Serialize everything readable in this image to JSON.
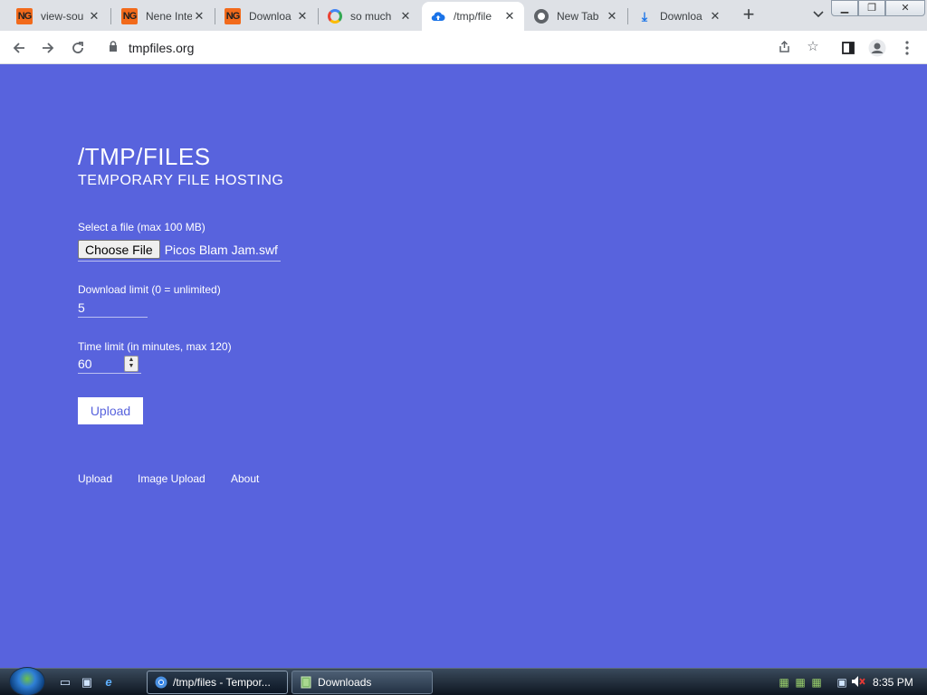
{
  "browser": {
    "tabs": [
      {
        "title": "view-sou",
        "icon": "newgrounds-icon"
      },
      {
        "title": "Nene Inte",
        "icon": "newgrounds-icon"
      },
      {
        "title": "Downloa",
        "icon": "newgrounds-icon"
      },
      {
        "title": "so much",
        "icon": "google-icon"
      },
      {
        "title": "/tmp/file",
        "icon": "cloud-upload-icon",
        "active": true
      },
      {
        "title": "New Tab",
        "icon": "chrome-icon"
      },
      {
        "title": "Downloa",
        "icon": "download-icon"
      }
    ],
    "url": "tmpfiles.org"
  },
  "page": {
    "title": "/TMP/FILES",
    "subtitle": "TEMPORARY FILE HOSTING",
    "file_label": "Select a file (max 100 MB)",
    "choose_file_label": "Choose File",
    "file_name": "Picos Blam Jam.swf",
    "download_limit_label": "Download limit (0 = unlimited)",
    "download_limit_value": "5",
    "time_limit_label": "Time limit (in minutes, max 120)",
    "time_limit_value": "60",
    "upload_button": "Upload",
    "footer_links": [
      "Upload",
      "Image Upload",
      "About"
    ]
  },
  "colors": {
    "page_background": "#5863dd",
    "text": "#ffffff"
  },
  "taskbar": {
    "tasks": [
      {
        "label": "/tmp/files - Tempor...",
        "icon": "chrome-icon",
        "active": true
      },
      {
        "label": "Downloads",
        "icon": "folder-icon"
      }
    ],
    "clock": "8:35 PM"
  }
}
